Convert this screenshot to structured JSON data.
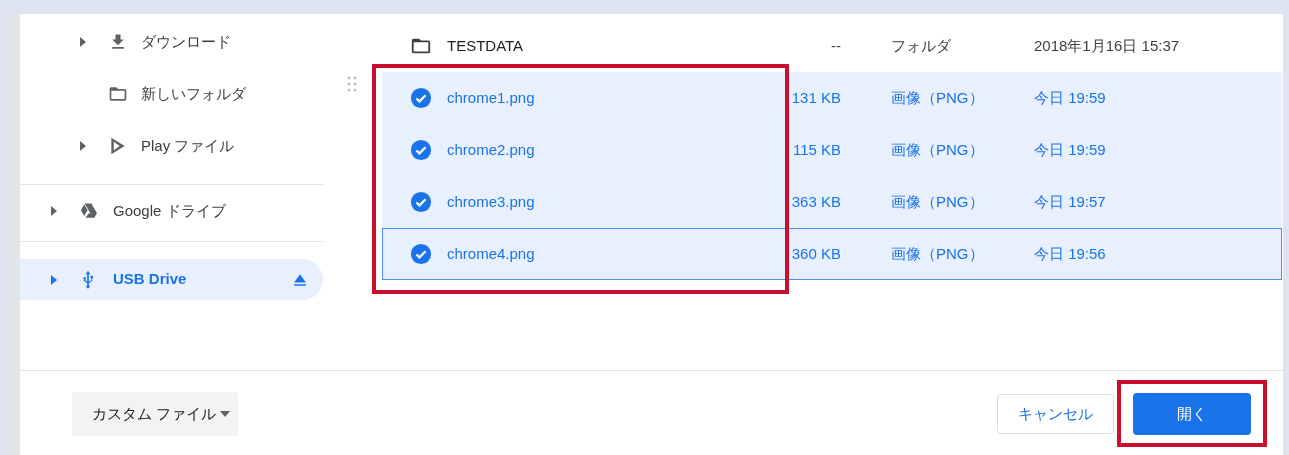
{
  "sidebar": {
    "sections": [
      {
        "kind": "nested",
        "items": [
          {
            "label": "ダウンロード",
            "kind": "downloads",
            "expandable": true,
            "selected": false
          },
          {
            "label": "新しいフォルダ",
            "kind": "folder",
            "expandable": false,
            "selected": false
          },
          {
            "label": "Play ファイル",
            "kind": "play",
            "expandable": true,
            "selected": false
          }
        ]
      },
      {
        "kind": "root",
        "items": [
          {
            "label": "Google ドライブ",
            "kind": "drive",
            "expandable": true,
            "selected": false
          }
        ]
      },
      {
        "kind": "root",
        "items": [
          {
            "label": "USB Drive",
            "kind": "usb",
            "expandable": true,
            "selected": true,
            "ejectable": true
          }
        ]
      }
    ]
  },
  "file_list": {
    "names_framed": true,
    "rows": [
      {
        "kind": "folder",
        "name": "TESTDATA",
        "size": "--",
        "type": "フォルダ",
        "modified": "2018年1月16日 15:37",
        "selected": false,
        "focused": false
      },
      {
        "kind": "file",
        "name": "chrome1.png",
        "size": "131 KB",
        "type": "画像（PNG）",
        "modified": "今日 19:59",
        "selected": true,
        "focused": false
      },
      {
        "kind": "file",
        "name": "chrome2.png",
        "size": "115 KB",
        "type": "画像（PNG）",
        "modified": "今日 19:59",
        "selected": true,
        "focused": false
      },
      {
        "kind": "file",
        "name": "chrome3.png",
        "size": "363 KB",
        "type": "画像（PNG）",
        "modified": "今日 19:57",
        "selected": true,
        "focused": false
      },
      {
        "kind": "file",
        "name": "chrome4.png",
        "size": "360 KB",
        "type": "画像（PNG）",
        "modified": "今日 19:56",
        "selected": true,
        "focused": true
      }
    ]
  },
  "footer": {
    "file_type_filter": "カスタム ファイル",
    "buttons": [
      {
        "label": "キャンセル",
        "kind": "secondary",
        "framed": false
      },
      {
        "label": "開く",
        "kind": "primary",
        "framed": true
      }
    ]
  }
}
